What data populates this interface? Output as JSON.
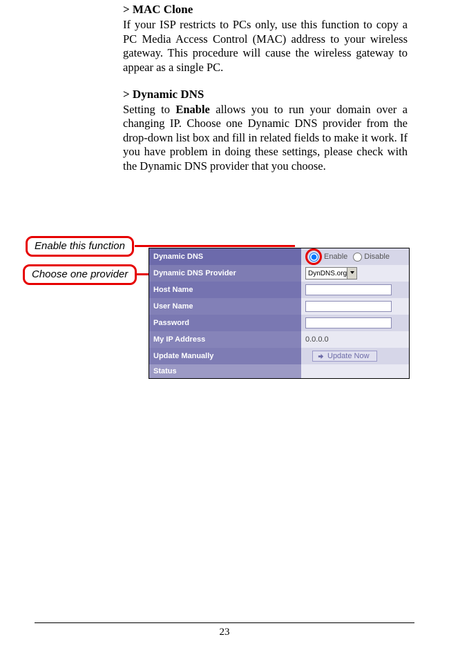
{
  "sections": {
    "mac_clone": {
      "title": "> MAC Clone",
      "body": "If your ISP restricts to PCs only, use this function to copy a PC Media Access Control (MAC) address to your wireless gateway.  This procedure will cause the wireless gateway to appear as a single PC."
    },
    "ddns": {
      "title": "> Dynamic DNS",
      "body_pre": "Setting to ",
      "body_bold": "Enable",
      "body_post": " allows you to run your domain over a changing IP.  Choose one Dynamic DNS provider from the drop-down list box and fill in related fields to make it work. If you have problem in doing these settings, please check with the Dynamic DNS provider that you choose."
    }
  },
  "callouts": {
    "enable": "Enable this function",
    "provider": "Choose one provider"
  },
  "panel": {
    "rows": {
      "ddns": {
        "label": "Dynamic DNS",
        "enable": "Enable",
        "disable": "Disable"
      },
      "provider": {
        "label": "Dynamic DNS Provider",
        "value": "DynDNS.org"
      },
      "hostname": {
        "label": "Host Name",
        "value": ""
      },
      "username": {
        "label": "User Name",
        "value": ""
      },
      "password": {
        "label": "Password",
        "value": ""
      },
      "myip": {
        "label": "My IP Address",
        "value": "0.0.0.0"
      },
      "update": {
        "label": "Update Manually",
        "button": "Update Now"
      },
      "status": {
        "label": "Status",
        "value": ""
      }
    }
  },
  "page_number": "23"
}
